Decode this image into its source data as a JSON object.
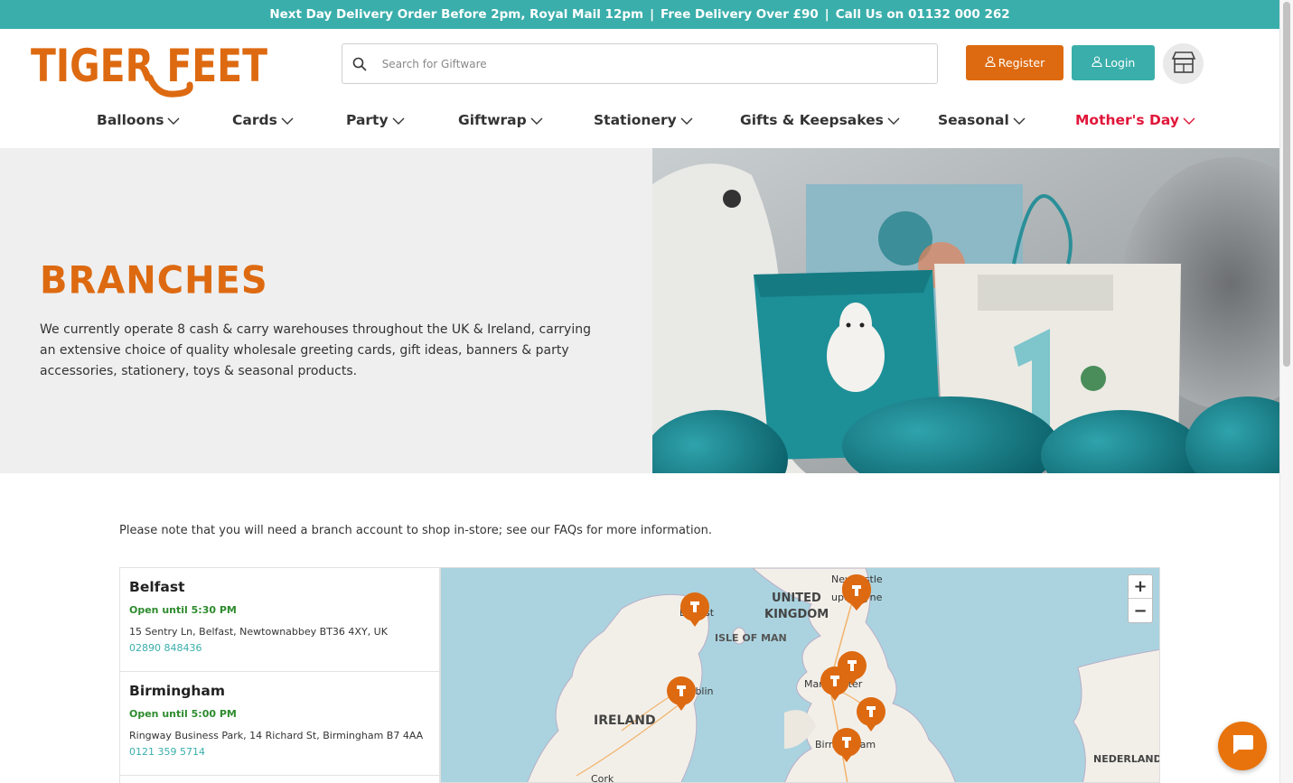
{
  "topbar": {
    "items": [
      "Next Day Delivery Order Before 2pm, Royal Mail 12pm",
      "Free Delivery Over £90",
      "Call Us on 01132 000 262"
    ],
    "separator": "|"
  },
  "brand": {
    "name": "TIGER FEET",
    "color": "#dd6a11"
  },
  "search": {
    "placeholder": "Search for Giftware"
  },
  "header": {
    "register_label": "Register",
    "login_label": "Login"
  },
  "nav": [
    {
      "label": "Balloons"
    },
    {
      "label": "Cards"
    },
    {
      "label": "Party"
    },
    {
      "label": "Giftwrap"
    },
    {
      "label": "Stationery"
    },
    {
      "label": "Gifts & Keepsakes"
    },
    {
      "label": "Seasonal"
    },
    {
      "label": "Mother's Day",
      "highlight_color": "#e0163a"
    }
  ],
  "hero": {
    "title": "BRANCHES",
    "text": "We currently operate 8 cash & carry warehouses throughout the UK & Ireland, carrying an extensive choice of quality wholesale greeting cards, gift ideas, banners & party accessories, stationery, toys & seasonal products."
  },
  "note": "Please note that you will need a branch account to shop in-store; see our FAQs for more information.",
  "branches": [
    {
      "name": "Belfast",
      "open": "Open until 5:30 PM",
      "address": "15 Sentry Ln, Belfast, Newtownabbey BT36 4XY, UK",
      "phone": "02890 848436"
    },
    {
      "name": "Birmingham",
      "open": "Open until 5:00 PM",
      "address": "Ringway Business Park, 14 Richard St, Birmingham B7 4AA",
      "phone": "0121 359 5714"
    }
  ],
  "map": {
    "labels": {
      "united": "UNITED",
      "kingdom": "KINGDOM",
      "isle_of_man": "ISLE OF MAN",
      "ireland": "IRELAND",
      "nederland": "NEDERLAND",
      "cork": "Cork",
      "newcastle_1": "Newcastle",
      "newcastle_2": "upon Tyne",
      "belfast": "Belfast",
      "dublin": "Dublin",
      "manchester": "Manchester",
      "birmingham": "Birmingham"
    },
    "zoom_in": "+",
    "zoom_out": "−",
    "marker_color": "#dd6a11"
  },
  "colors": {
    "teal": "#3aaeab",
    "orange": "#dd6a11",
    "open_green": "#2e8b2e"
  }
}
